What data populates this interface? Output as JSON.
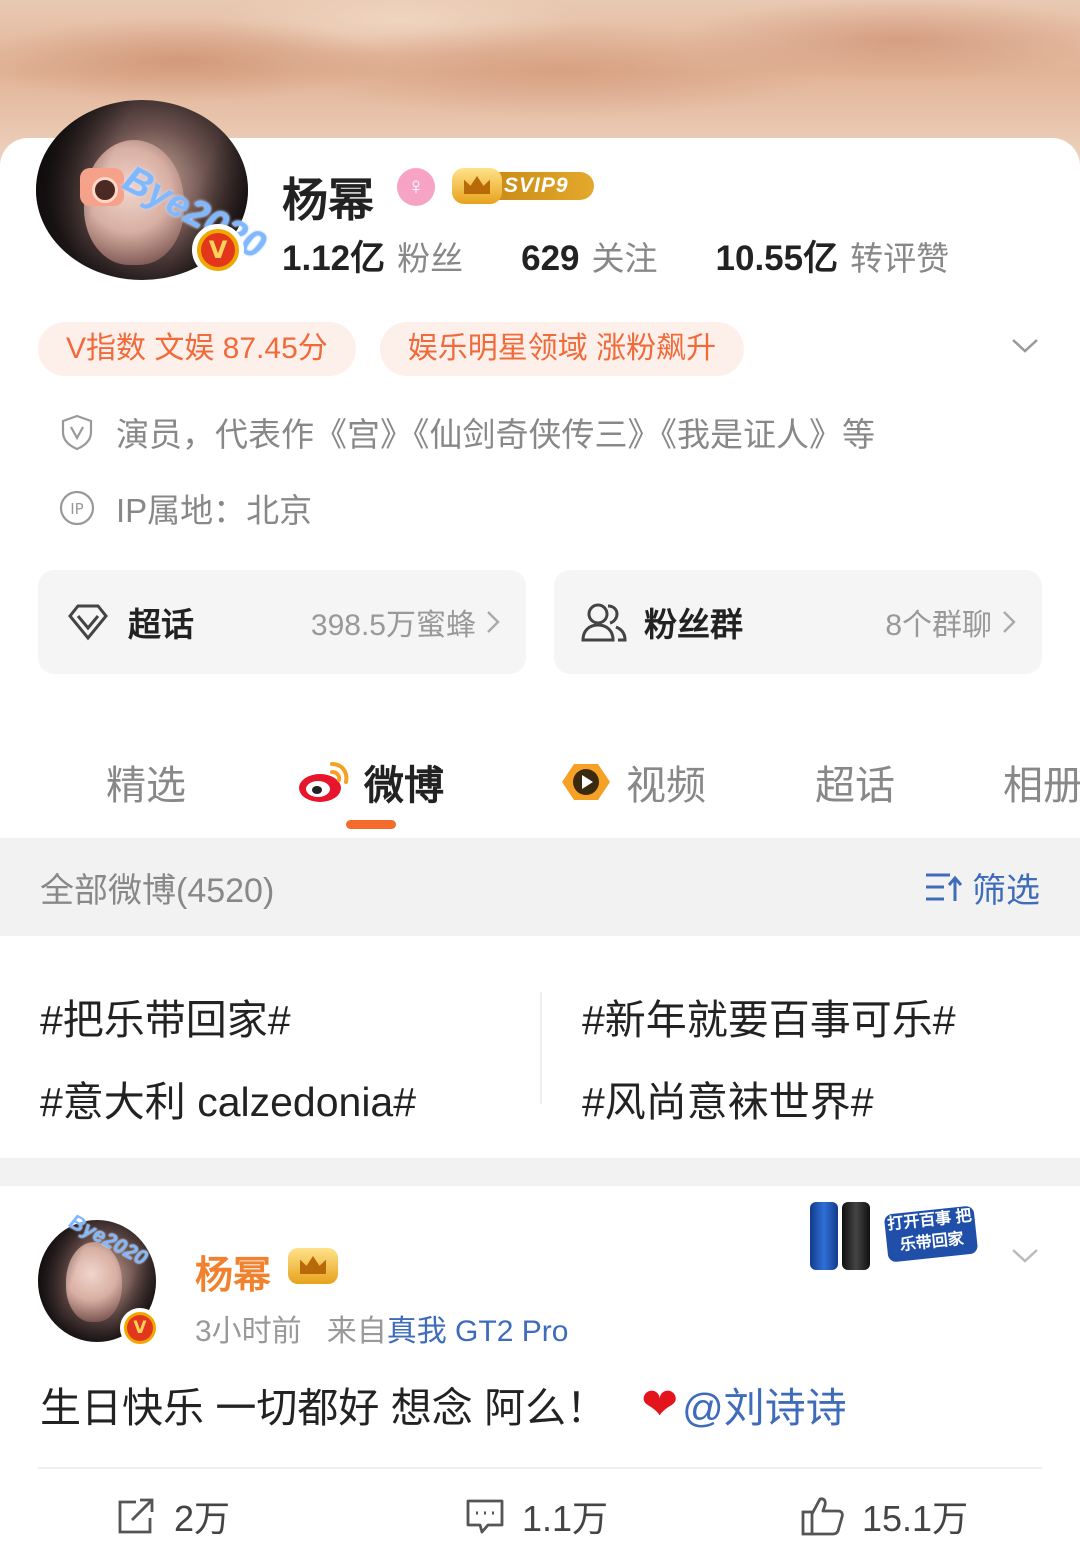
{
  "profile": {
    "name": "杨幂",
    "svip": "SVIP9",
    "avatar_tag": "Bye2020",
    "stats": [
      {
        "num": "1.12亿",
        "label": "粉丝"
      },
      {
        "num": "629",
        "label": "关注"
      },
      {
        "num": "10.55亿",
        "label": "转评赞"
      }
    ],
    "tags": [
      "V指数 文娱 87.45分",
      "娱乐明星领域 涨粉飙升"
    ],
    "description": "演员，代表作《宫》《仙剑奇侠传三》《我是证人》等",
    "ip_location": "IP属地：北京"
  },
  "cards": {
    "super_topic": {
      "title": "超话",
      "meta": "398.5万蜜蜂"
    },
    "fan_group": {
      "title": "粉丝群",
      "meta": "8个群聊"
    }
  },
  "tabs": [
    "精选",
    "微博",
    "视频",
    "超话",
    "相册"
  ],
  "active_tab": "微博",
  "filter_bar": {
    "count": "全部微博(4520)",
    "filter": "筛选"
  },
  "hashtags": [
    "#把乐带回家#",
    "#新年就要百事可乐#",
    "#意大利 calzedonia#",
    "#风尚意袜世界#"
  ],
  "post": {
    "author": "杨幂",
    "avatar_tag": "Bye2020",
    "time": "3小时前",
    "source_prefix": "来自",
    "device": "真我 GT2 Pro",
    "ad_text": "打开百事 把乐带回家",
    "text": "生日快乐 一切都好 想念 阿么！",
    "heart": "❤",
    "mention": "@刘诗诗",
    "actions": {
      "repost": "2万",
      "comment": "1.1万",
      "like": "15.1万"
    }
  },
  "colors": {
    "accent": "#f46b2b",
    "link": "#3f6cba",
    "tag_bg": "#fdf0ea",
    "tag_text": "#f06a3a",
    "grey_bg": "#f2f2f2"
  }
}
